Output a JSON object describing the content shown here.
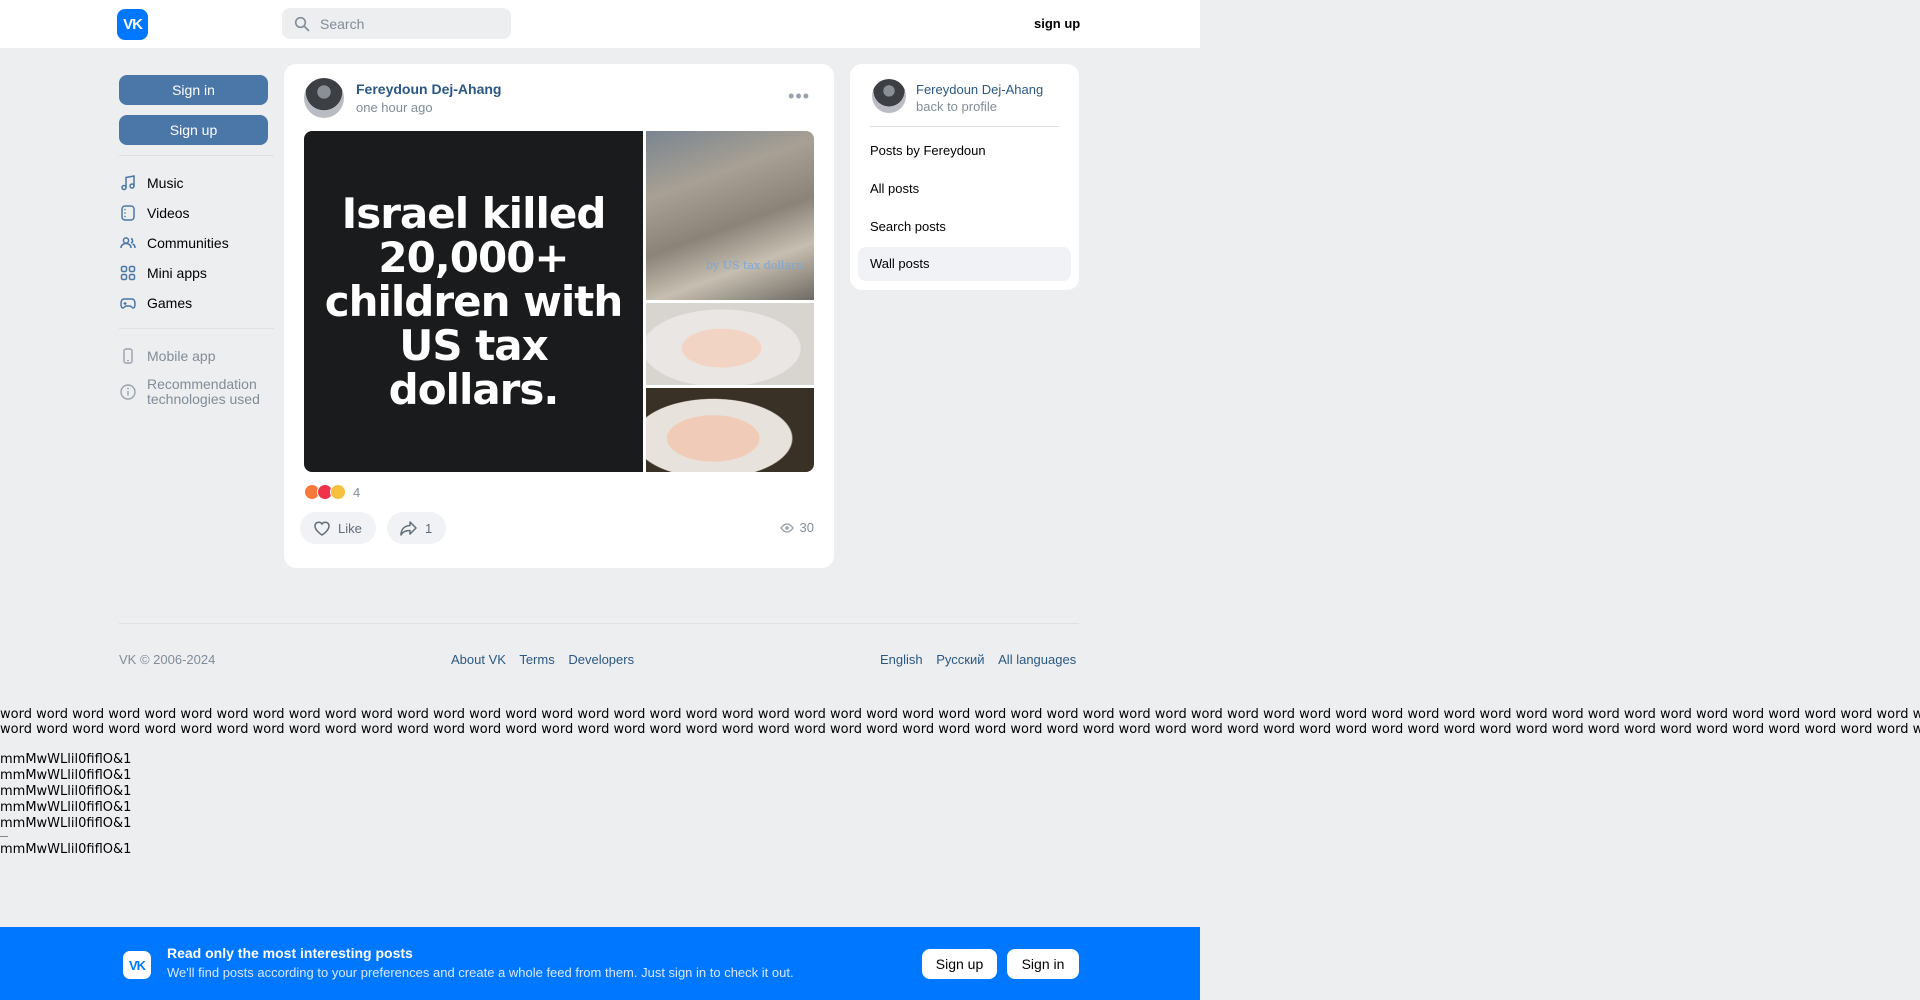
{
  "header": {
    "logo_text": "VK",
    "search_placeholder": "Search",
    "signup_label": "sign up"
  },
  "sidebar": {
    "signin_label": "Sign in",
    "signup_label": "Sign up",
    "items": [
      {
        "label": "Music",
        "icon": "music-icon"
      },
      {
        "label": "Videos",
        "icon": "video-icon"
      },
      {
        "label": "Communities",
        "icon": "communities-icon"
      },
      {
        "label": "Mini apps",
        "icon": "apps-icon"
      },
      {
        "label": "Games",
        "icon": "gamepad-icon"
      }
    ],
    "mobile_app": "Mobile app",
    "recommendation_line1": "Recommendation",
    "recommendation_line2": "technologies used"
  },
  "post": {
    "author": "Fereydoun Dej-Ahang",
    "time": "one hour ago",
    "image_text": "Israel killed 20,000+ children with US tax dollars.",
    "thumb1_caption": "by US tax dollars",
    "reaction_count": "4",
    "like_label": "Like",
    "share_count": "1",
    "views": "30"
  },
  "profile_panel": {
    "name": "Fereydoun Dej-Ahang",
    "back": "back to profile",
    "items": [
      "Posts by Fereydoun",
      "All posts",
      "Search posts",
      "Wall posts"
    ],
    "active_index": 3
  },
  "footer": {
    "copyright": "VK © 2006-2024",
    "links": [
      "About VK",
      "Terms",
      "Developers"
    ],
    "languages": [
      "English",
      "Русский",
      "All languages"
    ]
  },
  "debug_text": {
    "word_line": "word word word word word word word word word word word word word word word word word word word word word word word word word word word word word word word word word word word word word word word word word word word word word word word word word word word word word word word word word word word",
    "sample": "mmMwWLlil0fiflO&1"
  },
  "banner": {
    "title": "Read only the most interesting posts",
    "subtitle": "We'll find posts according to your preferences and create a whole feed from them. Just sign in to check it out.",
    "signup_label": "Sign up",
    "signin_label": "Sign in"
  },
  "colors": {
    "brand": "#0077ff",
    "link": "#2a5885",
    "button": "#4a76a8"
  }
}
